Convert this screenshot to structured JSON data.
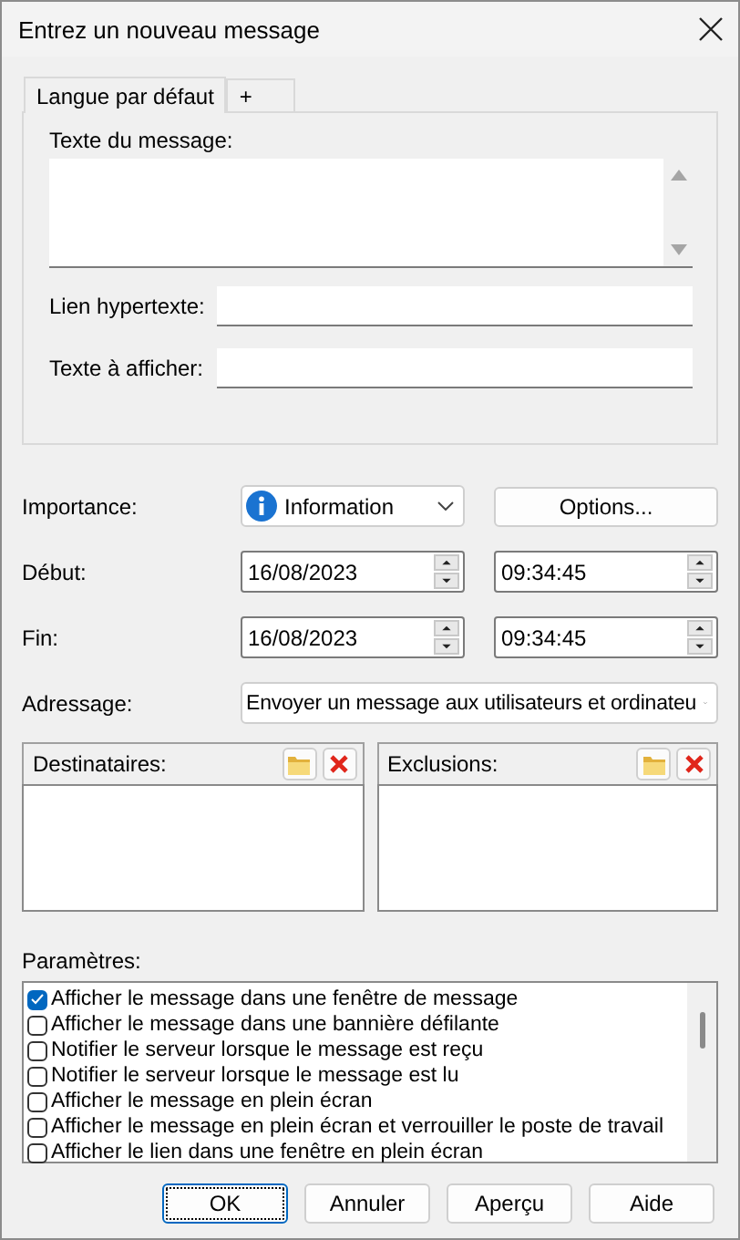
{
  "window": {
    "title": "Entrez un nouveau message"
  },
  "tabs": [
    {
      "label": "Langue par défaut",
      "selected": true
    },
    {
      "label": "+",
      "selected": false
    }
  ],
  "message": {
    "label": "Texte du message:"
  },
  "hyperlink": {
    "label": "Lien hypertexte:"
  },
  "display_text": {
    "label": "Texte à afficher:"
  },
  "importance": {
    "label": "Importance:",
    "value": "Information"
  },
  "options_button": "Options...",
  "start": {
    "label": "Début:",
    "date": "16/08/2023",
    "time": "09:34:45"
  },
  "end": {
    "label": "Fin:",
    "date": "16/08/2023",
    "time": "09:34:45"
  },
  "addressing": {
    "label": "Adressage:",
    "value": "Envoyer un message aux utilisateurs et ordinateu"
  },
  "recipients": {
    "label": "Destinataires:"
  },
  "exclusions": {
    "label": "Exclusions:"
  },
  "parameters": {
    "label": "Paramètres:",
    "items": [
      {
        "label": "Afficher le message dans une fenêtre de message",
        "checked": true
      },
      {
        "label": "Afficher le message dans une bannière défilante",
        "checked": false
      },
      {
        "label": "Notifier le serveur lorsque le message est reçu",
        "checked": false
      },
      {
        "label": "Notifier le serveur lorsque le message est lu",
        "checked": false
      },
      {
        "label": "Afficher le message en plein écran",
        "checked": false
      },
      {
        "label": "Afficher le message en plein écran et verrouiller le poste de travail",
        "checked": false
      },
      {
        "label": "Afficher le lien dans une fenêtre en plein écran",
        "checked": false
      }
    ]
  },
  "buttons": [
    {
      "label": "OK",
      "focused": true
    },
    {
      "label": "Annuler",
      "focused": false
    },
    {
      "label": "Aperçu",
      "focused": false
    },
    {
      "label": "Aide",
      "focused": false
    }
  ]
}
